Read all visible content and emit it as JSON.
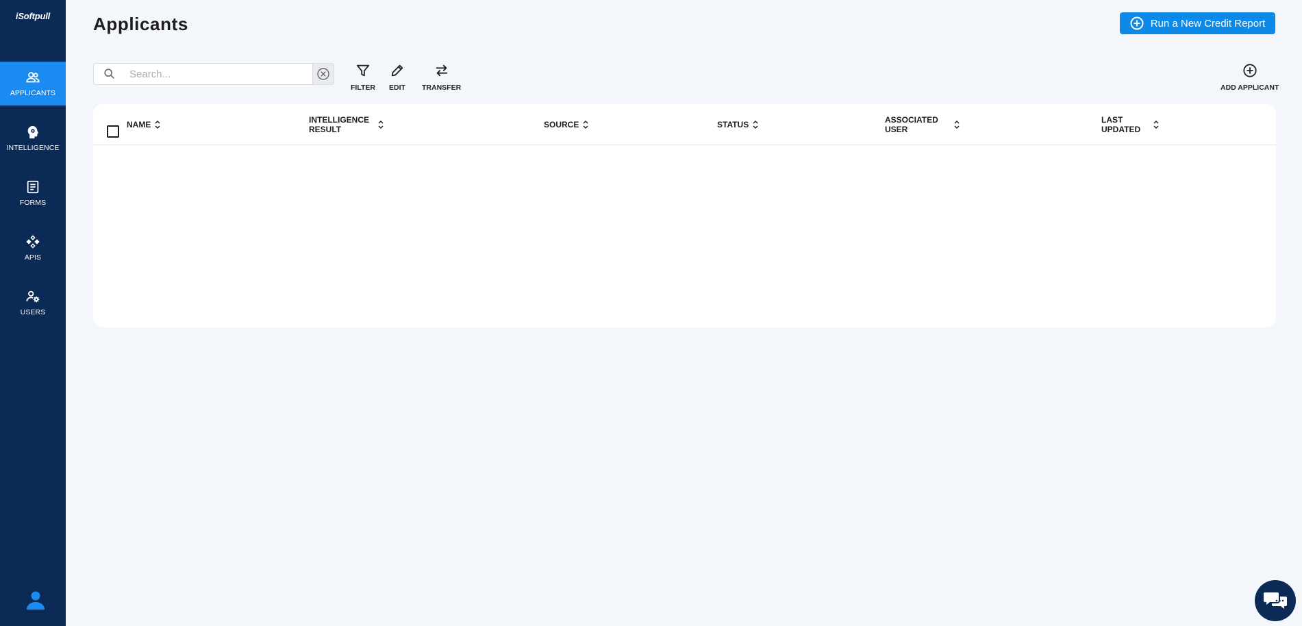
{
  "app": {
    "logo": "iSoftpull"
  },
  "sidebar": {
    "items": [
      {
        "label": "APPLICANTS",
        "icon": "users-icon",
        "active": true
      },
      {
        "label": "INTELLIGENCE",
        "icon": "brain-head-icon",
        "active": false
      },
      {
        "label": "FORMS",
        "icon": "form-icon",
        "active": false
      },
      {
        "label": "APIS",
        "icon": "api-icon",
        "active": false
      },
      {
        "label": "USERS",
        "icon": "user-gear-icon",
        "active": false
      }
    ],
    "profile_icon": "profile-icon"
  },
  "header": {
    "title": "Applicants",
    "primary_action": "Run a New Credit Report"
  },
  "toolbar": {
    "search_placeholder": "Search...",
    "filter_label": "FILTER",
    "edit_label": "EDIT",
    "transfer_label": "TRANSFER",
    "add_label": "ADD APPLICANT"
  },
  "table": {
    "columns": [
      "NAME",
      "INTELLIGENCE RESULT",
      "SOURCE",
      "STATUS",
      "ASSOCIATED USER",
      "LAST UPDATED"
    ],
    "rows": []
  },
  "colors": {
    "sidebar": "#0b2a55",
    "accent": "#1a8bf0",
    "primary_button": "#0d8ae8",
    "background": "#f3f7fc"
  }
}
